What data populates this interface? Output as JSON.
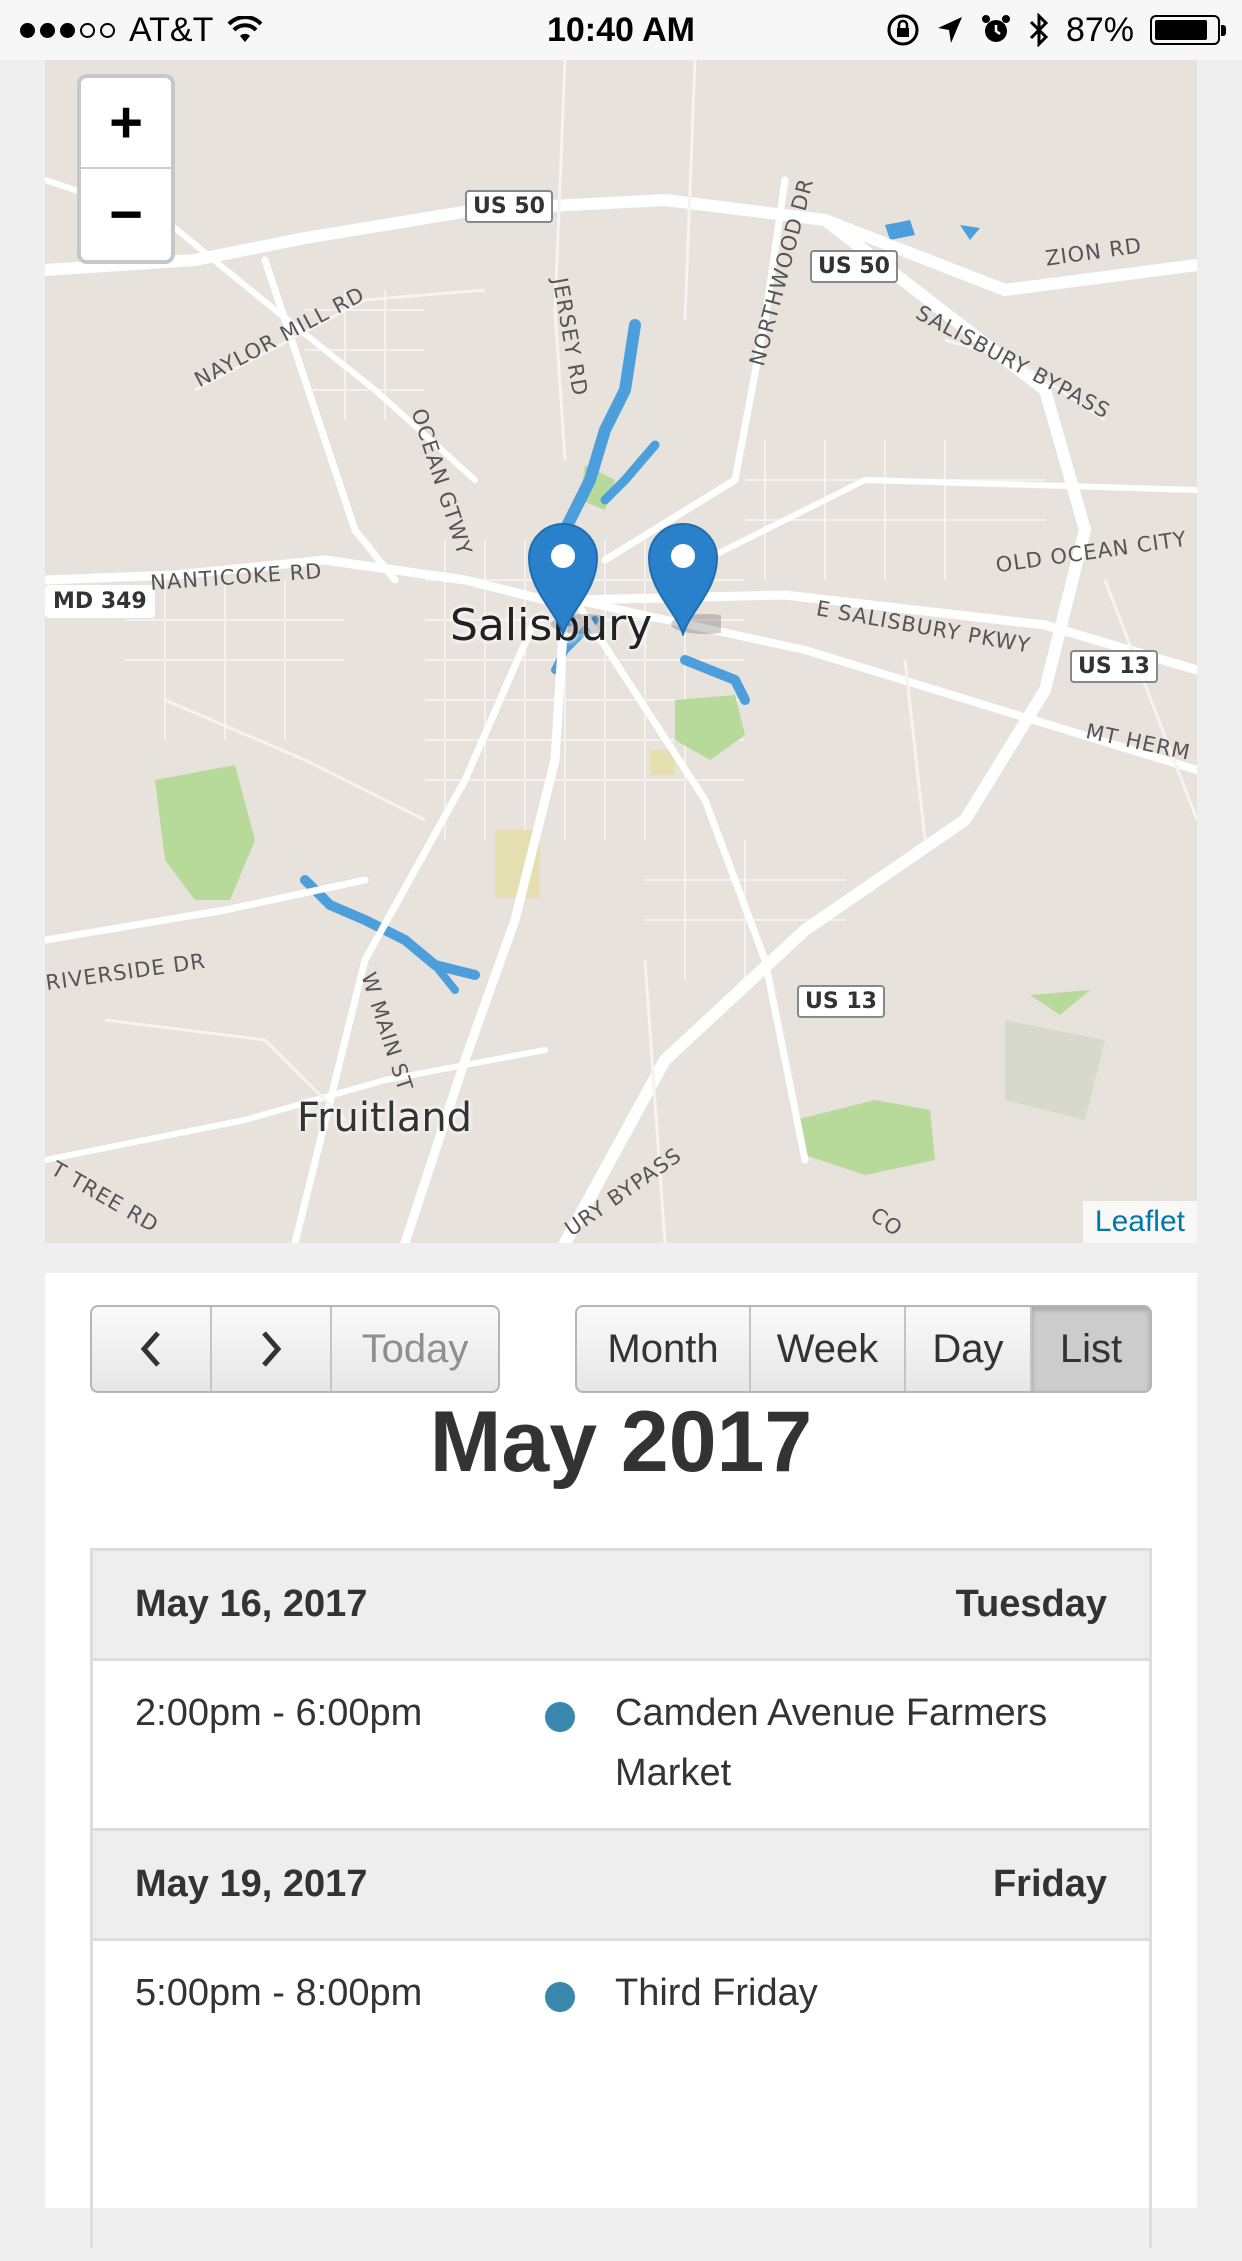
{
  "status_bar": {
    "carrier": "AT&T",
    "time": "10:40 AM",
    "battery_percent": "87%",
    "battery_level": 0.87
  },
  "map": {
    "zoom_in": "+",
    "zoom_out": "−",
    "attribution": "Leaflet",
    "cities": [
      "Salisbury",
      "Fruitland"
    ],
    "roads": [
      "US 50",
      "US 50",
      "US 13",
      "US 13",
      "ZION RD",
      "SALISBURY BYPASS",
      "NAYLOR MILL RD",
      "JERSEY RD",
      "NORTHWOOD DR",
      "OCEAN GTWY",
      "MD 349",
      "NANTICOKE RD",
      "OLD OCEAN CITY",
      "E SALISBURY PKWY",
      "MT HERM",
      "RIVERSIDE DR",
      "W MAIN ST",
      "T TREE RD",
      "URY BYPASS",
      "CO"
    ],
    "colors": {
      "land": "#e8e2dc",
      "water": "#4d9fdc",
      "park": "#b7d99a",
      "road": "#ffffff",
      "marker": "#2a81cb"
    }
  },
  "calendar": {
    "prev_label": "<",
    "next_label": ">",
    "today_label": "Today",
    "views": [
      "Month",
      "Week",
      "Day",
      "List"
    ],
    "active_view": "List",
    "title": "May 2017",
    "days": [
      {
        "date": "May 16, 2017",
        "weekday": "Tuesday",
        "events": [
          {
            "time": "2:00pm - 6:00pm",
            "title": "Camden Avenue Farmers Market"
          }
        ]
      },
      {
        "date": "May 19, 2017",
        "weekday": "Friday",
        "events": [
          {
            "time": "5:00pm - 8:00pm",
            "title": "Third Friday"
          }
        ]
      }
    ],
    "event_color": "#3a87ad"
  }
}
